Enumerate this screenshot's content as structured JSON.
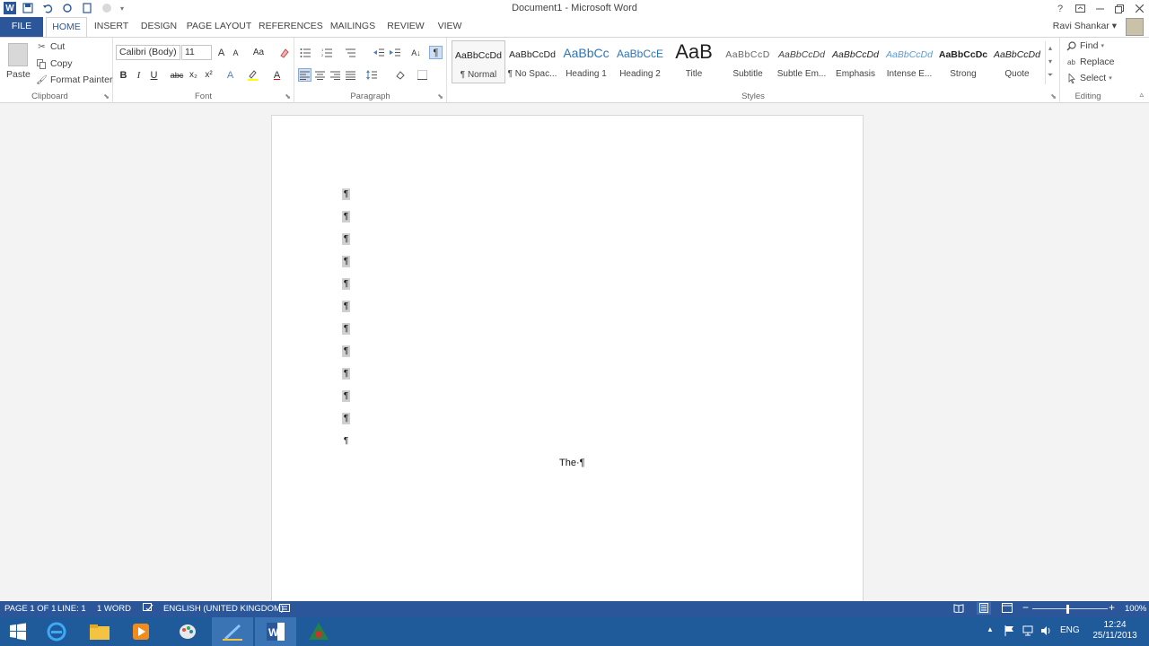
{
  "window": {
    "title": "Document1 - Microsoft Word",
    "user_name": "Ravi Shankar"
  },
  "quick_access": {
    "word_icon_letter": "W"
  },
  "tabs": [
    {
      "label": "FILE"
    },
    {
      "label": "HOME"
    },
    {
      "label": "INSERT"
    },
    {
      "label": "DESIGN"
    },
    {
      "label": "PAGE LAYOUT"
    },
    {
      "label": "REFERENCES"
    },
    {
      "label": "MAILINGS"
    },
    {
      "label": "REVIEW"
    },
    {
      "label": "VIEW"
    }
  ],
  "clipboard": {
    "paste": "Paste",
    "cut": "Cut",
    "copy": "Copy",
    "format_painter": "Format Painter",
    "group_label": "Clipboard"
  },
  "font": {
    "font_name": "Calibri (Body)",
    "font_size": "11",
    "group_label": "Font",
    "bold": "B",
    "italic": "I",
    "underline": "U",
    "strike": "abc",
    "subscript": "x₂",
    "superscript": "x²",
    "grow": "A",
    "shrink": "A",
    "change_case": "Aa",
    "text_effects": "A",
    "font_color": "A"
  },
  "paragraph": {
    "group_label": "Paragraph",
    "show_marks": "¶"
  },
  "styles": {
    "group_label": "Styles",
    "items": [
      {
        "preview": "AaBbCcDd",
        "name": "¶ Normal"
      },
      {
        "preview": "AaBbCcDd",
        "name": "¶ No Spac..."
      },
      {
        "preview": "AaBbCc",
        "name": "Heading 1"
      },
      {
        "preview": "AaBbCcE",
        "name": "Heading 2"
      },
      {
        "preview": "AaB",
        "name": "Title"
      },
      {
        "preview": "AaBbCcD",
        "name": "Subtitle"
      },
      {
        "preview": "AaBbCcDd",
        "name": "Subtle Em..."
      },
      {
        "preview": "AaBbCcDd",
        "name": "Emphasis"
      },
      {
        "preview": "AaBbCcDd",
        "name": "Intense E..."
      },
      {
        "preview": "AaBbCcDc",
        "name": "Strong"
      },
      {
        "preview": "AaBbCcDd",
        "name": "Quote"
      }
    ]
  },
  "editing": {
    "group_label": "Editing",
    "find": "Find",
    "replace": "Replace",
    "select": "Select"
  },
  "document": {
    "paragraph_mark": "¶",
    "body_text": "The·¶"
  },
  "statusbar": {
    "page": "PAGE 1 OF 1",
    "line": "LINE: 1",
    "words": "1 WORD",
    "language": "ENGLISH (UNITED KINGDOM)",
    "zoom": "100%",
    "zoom_level_percent": 100
  },
  "taskbar": {
    "ime": "ENG",
    "time": "12:24",
    "date": "25/11/2013"
  },
  "colors": {
    "accent": "#2b579a",
    "taskbar": "#1f5a9a"
  }
}
